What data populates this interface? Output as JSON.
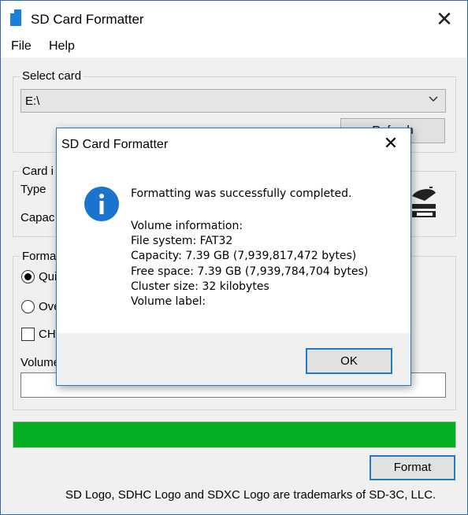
{
  "window": {
    "title": "SD Card Formatter",
    "close_glyph": "✕"
  },
  "menu": {
    "items": [
      "File",
      "Help"
    ]
  },
  "select_card": {
    "label": "Select card",
    "value": "E:\\",
    "refresh_label": "Refresh"
  },
  "card_info": {
    "label": "Card i",
    "type_label": "Type",
    "capacity_label": "Capac"
  },
  "format_options": {
    "label": "Forma",
    "quick_label": "Qui",
    "overwrite_label": "Ove",
    "chs_label": "CH",
    "selected": "quick"
  },
  "volume": {
    "label": "Volume",
    "value": ""
  },
  "progress": {
    "percent": 100,
    "color": "#06b025"
  },
  "format_button": {
    "label": "Format"
  },
  "footer": {
    "text": "SD Logo, SDHC Logo and SDXC Logo are trademarks of SD-3C, LLC."
  },
  "dialog": {
    "title": "SD Card Formatter",
    "close_glyph": "✕",
    "icon": "info-icon",
    "message": "Formatting was successfully completed.",
    "volume_info_heading": "Volume information:",
    "file_system": "File system: FAT32",
    "capacity": "Capacity: 7.39 GB (7,939,817,472 bytes)",
    "free_space": "Free space: 7.39 GB (7,939,784,704 bytes)",
    "cluster_size": "Cluster size: 32 kilobytes",
    "volume_label": "Volume label:",
    "ok_label": "OK"
  },
  "colors": {
    "accent": "#1f7ad0",
    "progress": "#06b025",
    "info_icon": "#1a73cc"
  }
}
